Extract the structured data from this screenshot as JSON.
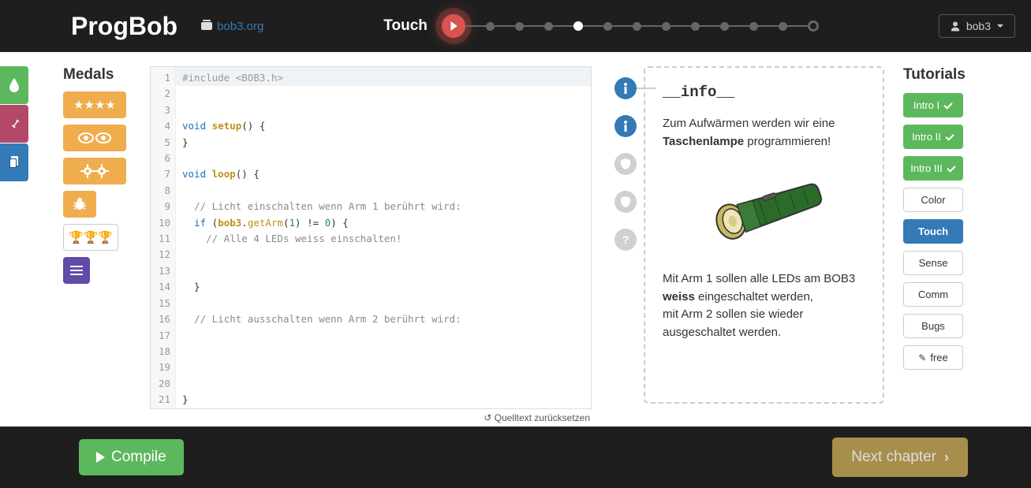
{
  "header": {
    "logo": "ProgBob",
    "site": "bob3.org",
    "chapter": "Touch",
    "user": "bob3"
  },
  "medals": {
    "title": "Medals"
  },
  "code": {
    "lines": [
      "#include <BOB3.h>",
      "",
      "void setup() {",
      "}",
      "",
      "void loop() {",
      "",
      "  // Licht einschalten wenn Arm 1 berührt wird:",
      "  if (bob3.getArm(1) != 0) {",
      "    // Alle 4 LEDs weiss einschalten!",
      "",
      "",
      "  }",
      "",
      "  // Licht ausschalten wenn Arm 2 berührt wird:",
      "",
      "",
      "",
      "",
      "}",
      ""
    ],
    "reset": "Quelltext zurücksetzen"
  },
  "info": {
    "title": "__info__",
    "p1a": "Zum Aufwärmen werden wir eine ",
    "p1b": "Taschenlampe",
    "p1c": " programmieren!",
    "p2a": "Mit Arm 1 sollen alle LEDs am BOB3 ",
    "p2b": "weiss",
    "p2c": " eingeschaltet werden,",
    "p2d": "mit Arm 2 sollen sie wieder ausgeschaltet werden."
  },
  "tutorials": {
    "title": "Tutorials",
    "items": [
      {
        "label": "Intro I",
        "type": "green",
        "check": true
      },
      {
        "label": "Intro II",
        "type": "green",
        "check": true
      },
      {
        "label": "Intro III",
        "type": "green",
        "check": true
      },
      {
        "label": "Color",
        "type": "outline"
      },
      {
        "label": "Touch",
        "type": "blue"
      },
      {
        "label": "Sense",
        "type": "outline"
      },
      {
        "label": "Comm",
        "type": "outline"
      },
      {
        "label": "Bugs",
        "type": "outline"
      },
      {
        "label": "free",
        "type": "outline",
        "icon": "pencil"
      }
    ]
  },
  "footer": {
    "compile": "Compile",
    "next": "Next chapter"
  }
}
